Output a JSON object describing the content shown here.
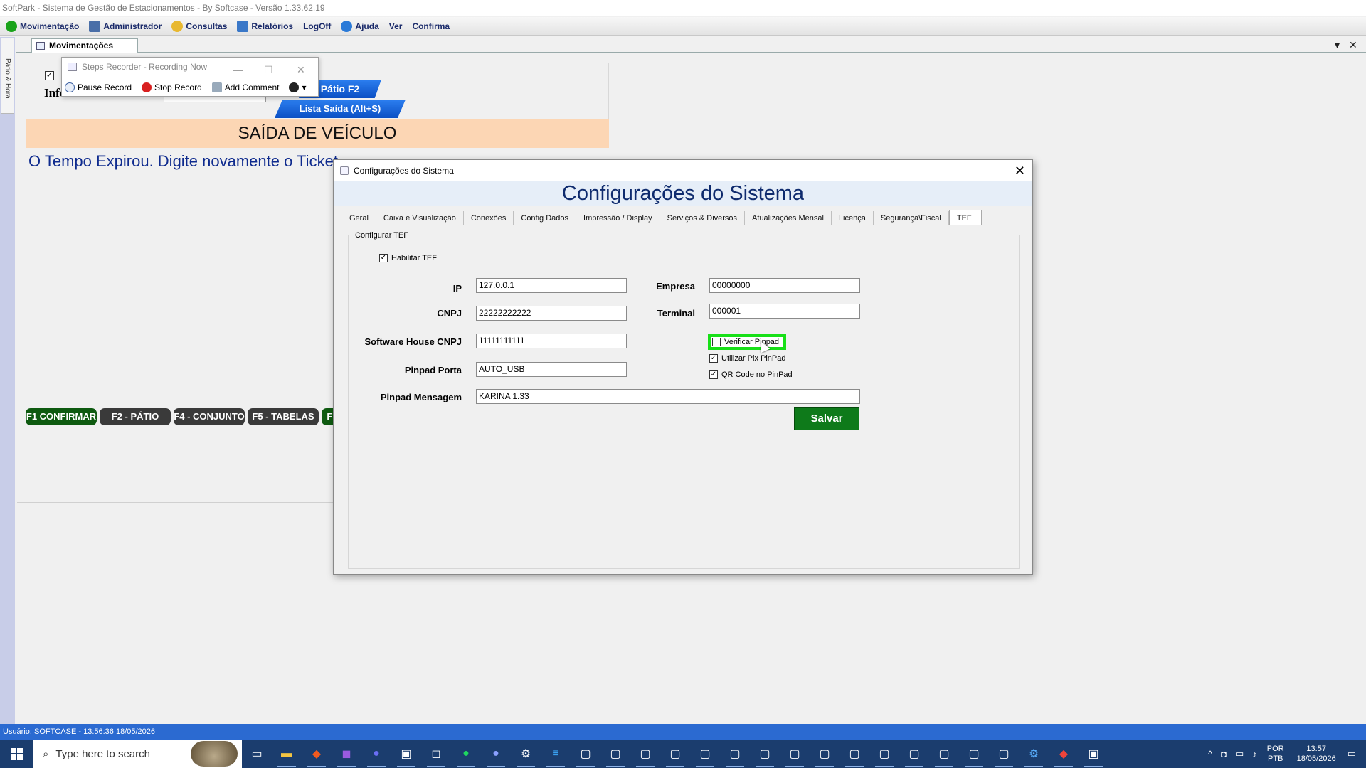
{
  "window": {
    "title": "SoftPark - Sistema de Gestão de Estacionamentos - By Softcase - Versão 1.33.62.19"
  },
  "menubar": {
    "items": [
      {
        "label": "Movimentação",
        "color": "#1aa31a"
      },
      {
        "label": "Administrador",
        "color": "#4a6fa8"
      },
      {
        "label": "Consultas",
        "color": "#e8b830"
      },
      {
        "label": "Relatórios",
        "color": "#3a78c8"
      },
      {
        "label": "LogOff",
        "color": ""
      },
      {
        "label": "Ajuda",
        "color": "#2a7ad8"
      },
      {
        "label": "Ver",
        "color": ""
      },
      {
        "label": "Confirma",
        "color": ""
      }
    ]
  },
  "side_pin": {
    "label": "Pátio & Hora"
  },
  "doc_tab": {
    "label": "Movimentações"
  },
  "main": {
    "ticket_label": "Informe o Ticket",
    "patio_button": "Pátio F2",
    "lista_button": "Lista Saída (Alt+S)",
    "banner": "SAÍDA DE VEÍCULO",
    "expired_msg": "O Tempo Expirou. Digite novamente o Ticket",
    "fn_buttons": [
      {
        "label": "F1 CONFIRMAR",
        "color": "#0e5a10"
      },
      {
        "label": "F2 - PÁTIO",
        "color": "#3a3a3a"
      },
      {
        "label": "F4 - CONJUNTO",
        "color": "#3a3a3a"
      },
      {
        "label": "F5 - TABELAS",
        "color": "#3a3a3a"
      },
      {
        "label": "F7",
        "color": "#0e5a10"
      }
    ]
  },
  "steps_recorder": {
    "title": "Steps Recorder - Recording Now",
    "pause": "Pause Record",
    "stop": "Stop Record",
    "comment": "Add Comment"
  },
  "dialog": {
    "title": "Configurações do Sistema",
    "header": "Configurações do Sistema",
    "tabs": [
      "Geral",
      "Caixa e Visualização",
      "Conexões",
      "Config Dados",
      "Impressão / Display",
      "Serviços & Diversos",
      "Atualizações Mensal",
      "Licença",
      "Segurança\\Fiscal",
      "TEF"
    ],
    "group_label": "Configurar TEF",
    "habilitar_tef": {
      "label": "Habilitar TEF",
      "checked": true
    },
    "fields": {
      "ip": {
        "label": "IP",
        "value": "127.0.0.1"
      },
      "cnpj": {
        "label": "CNPJ",
        "value": "22222222222"
      },
      "sw_house_cnpj": {
        "label": "Software House CNPJ",
        "value": "11111111111"
      },
      "pinpad_porta": {
        "label": "Pinpad Porta",
        "value": "AUTO_USB"
      },
      "pinpad_mensagem": {
        "label": "Pinpad Mensagem",
        "value": "KARINA 1.33"
      },
      "empresa": {
        "label": "Empresa",
        "value": "00000000"
      },
      "terminal": {
        "label": "Terminal",
        "value": "000001"
      }
    },
    "checks": {
      "verificar_pinpad": {
        "label": "Verificar Pinpad",
        "checked": false
      },
      "utilizar_pix": {
        "label": "Utilizar Pix PinPad",
        "checked": true
      },
      "qr_code": {
        "label": "QR Code no PinPad",
        "checked": true
      }
    },
    "save_label": "Salvar"
  },
  "statusbar": {
    "text": "Usuário:  SOFTCASE - 13:56:36 18/05/2026"
  },
  "taskbar": {
    "search_placeholder": "Type here to search",
    "lang_top": "POR",
    "lang_bottom": "PTB",
    "time": "13:57",
    "date": "18/05/2026"
  }
}
